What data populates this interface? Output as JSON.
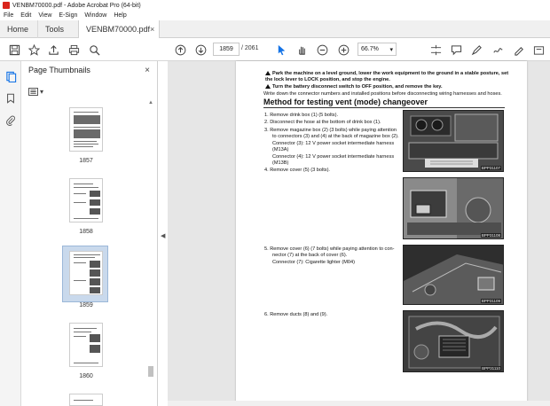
{
  "window": {
    "title": "VENBM70000.pdf - Adobe Acrobat Pro (64-bit)"
  },
  "menu": [
    "File",
    "Edit",
    "View",
    "E-Sign",
    "Window",
    "Help"
  ],
  "tabs": {
    "home": "Home",
    "tools": "Tools",
    "document": "VENBM70000.pdf",
    "close": "×"
  },
  "toolbar": {
    "current_page": "1859",
    "total_pages": "/ 2061",
    "zoom": "66.7%"
  },
  "panel": {
    "title": "Page Thumbnails",
    "close": "×"
  },
  "thumbnails": [
    {
      "label": "1857"
    },
    {
      "label": "1858"
    },
    {
      "label": "1859",
      "selected": true
    },
    {
      "label": "1860"
    }
  ],
  "document": {
    "warning1": "Park the machine on a level ground, lower the work equipment to the ground in a stable posture, set the lock lever to LOCK position, and stop the engine.",
    "warning2": "Turn the battery disconnect switch to OFF position, and remove the key.",
    "note": "Write down the connector numbers and installed positions before disconnecting wiring harnesses and hoses.",
    "heading": "Method for testing vent (mode) changeover",
    "steps": {
      "s1": "1.   Remove drink box (1) (5 bolts).",
      "s2": "2.   Disconnect the hose at the bottom of drink box (1).",
      "s3a": "3.   Remove magazine box (2) (3 bolts) while paying attention",
      "s3b": "to connectors (3) and (4) at the back of magazine box (2).",
      "s3c": "Connector (3): 12 V power socket intermediate harness",
      "s3d": "(M13A)",
      "s3e": "Connector (4): 12 V power socket intermediate harness",
      "s3f": "(M13B)",
      "s4": "4.   Remove cover (5) (3 bolts).",
      "s5a": "5.   Remove cover (6) (7 bolts) while paying attention to con-",
      "s5b": "nector (7) at the back of cover (6).",
      "s5c": "Connector (7): Cigarette lighter (M04)",
      "s6": "6.   Remove ducts (8) and (9)."
    },
    "captions": [
      "BPP31107",
      "BPP31108",
      "BPP31109",
      "BPP31110"
    ]
  },
  "colors": {
    "accent": "#1473e6",
    "pdf_red": "#d9251c",
    "viewer_bg": "#e6e6e6"
  }
}
